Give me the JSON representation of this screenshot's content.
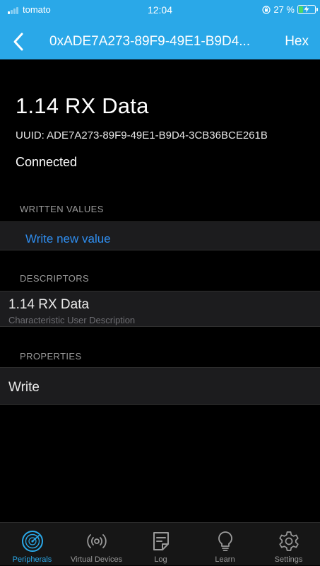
{
  "status_bar": {
    "carrier": "tomato",
    "time": "12:04",
    "battery_text": "27 %",
    "battery_level": 0.27,
    "icons": [
      "signal-icon",
      "orientation-lock-icon",
      "battery-charging-icon"
    ]
  },
  "nav": {
    "title": "0xADE7A273-89F9-49E1-B9D4...",
    "right_button": "Hex",
    "back_icon": "chevron-left-icon"
  },
  "characteristic": {
    "name": "1.14 RX Data",
    "uuid": "UUID: ADE7A273-89F9-49E1-B9D4-3CB36BCE261B",
    "status": "Connected"
  },
  "sections": {
    "written_values": {
      "header": "WRITTEN VALUES",
      "action": "Write new value"
    },
    "descriptors": {
      "header": "DESCRIPTORS",
      "items": [
        {
          "title": "1.14 RX Data",
          "subtitle": "Characteristic User Description"
        }
      ]
    },
    "properties": {
      "header": "PROPERTIES",
      "items": [
        "Write"
      ]
    }
  },
  "tabs": [
    {
      "label": "Peripherals",
      "icon": "radar-icon",
      "active": true
    },
    {
      "label": "Virtual Devices",
      "icon": "broadcast-icon",
      "active": false
    },
    {
      "label": "Log",
      "icon": "log-icon",
      "active": false
    },
    {
      "label": "Learn",
      "icon": "lightbulb-icon",
      "active": false
    },
    {
      "label": "Settings",
      "icon": "gear-icon",
      "active": false
    }
  ],
  "colors": {
    "accent": "#2aa8e8",
    "link": "#2f8ef0",
    "background": "#000000",
    "cell": "#1c1c1e",
    "battery": "#4cd964"
  }
}
